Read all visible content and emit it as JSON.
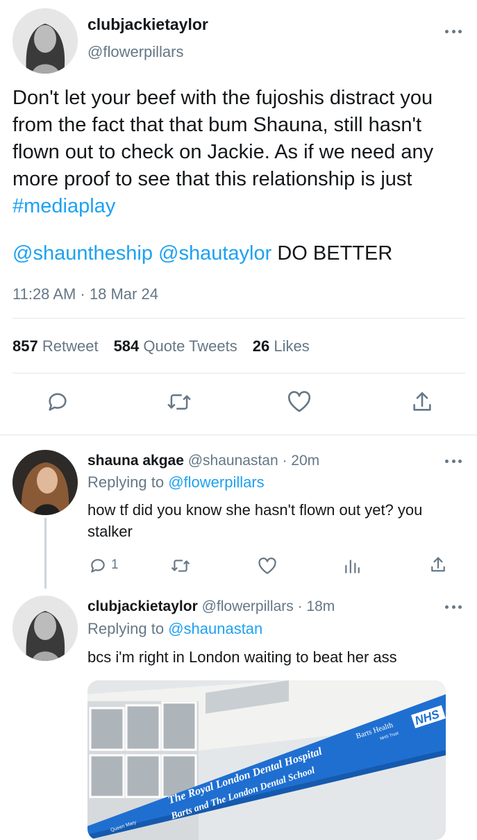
{
  "main_tweet": {
    "display_name": "clubjackietaylor",
    "handle": "@flowerpillars",
    "text_parts": {
      "p1": "Don't let your beef with the fujoshis distract you from the fact that that bum Shauna, still hasn't flown out to check on Jackie. As if we need any more proof to see that this relationship is just ",
      "hashtag": "#mediaplay"
    },
    "mention1": "@shauntheship",
    "mention2": "@shautaylor",
    "shout": " DO BETTER",
    "timestamp": "11:28 AM · 18 Mar 24",
    "stats": {
      "retweets": "857",
      "retweets_label": "Retweet",
      "quotes": "584",
      "quotes_label": "Quote Tweets",
      "likes": "26",
      "likes_label": "Likes"
    }
  },
  "reply1": {
    "display_name": "shauna akgae",
    "handle_time": " @shaunastan · 20m",
    "replying_prefix": "Replying to ",
    "replying_to": "@flowerpillars",
    "text": "how tf did you know she hasn't flown out yet? you stalker",
    "reply_count": "1"
  },
  "reply2": {
    "display_name": "clubjackietaylor",
    "handle_time": " @flowerpillars · 18m",
    "replying_prefix": "Replying to ",
    "replying_to": "@shaunastan",
    "text": "bcs i'm right in London waiting to beat her ass",
    "image": {
      "sign_line1": "The Royal London Dental Hospital",
      "sign_line2": "Barts and The London Dental School",
      "brand": "Barts Health",
      "nhs": "NHS",
      "trust": "NHS Trust",
      "queen_mary": "Queen Mary"
    }
  },
  "colors": {
    "link": "#1da1f2",
    "muted": "#657786",
    "divider": "#e1e8ed"
  }
}
